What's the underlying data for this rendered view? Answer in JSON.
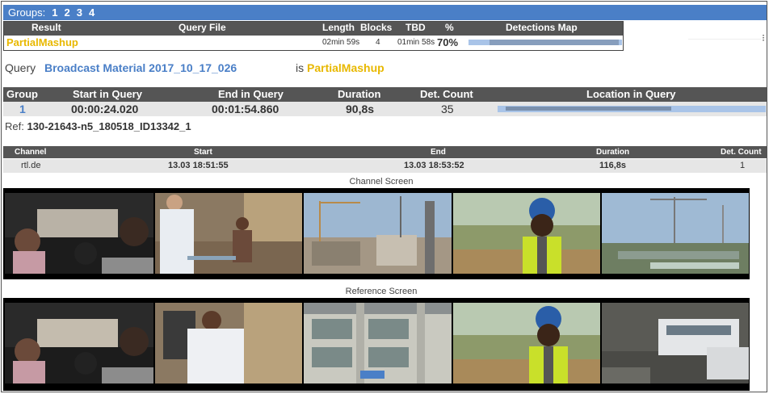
{
  "groups": {
    "label": "Groups:",
    "items": [
      "1",
      "2",
      "3",
      "4"
    ]
  },
  "result_table": {
    "headers": {
      "result": "Result",
      "query_file": "Query File",
      "length": "Length",
      "blocks": "Blocks",
      "tbd": "TBD",
      "pct": "%",
      "det_map": "Detections Map"
    },
    "row": {
      "result": "PartialMashup",
      "query_file": "",
      "length": "02min 59s",
      "blocks": "4",
      "tbd": "01min 58s",
      "pct": "70%"
    }
  },
  "query": {
    "label": "Query",
    "name": "Broadcast Material 2017_10_17_026",
    "is_label": "is",
    "status": "PartialMashup"
  },
  "group_table": {
    "headers": {
      "group": "Group",
      "start": "Start in Query",
      "end": "End in Query",
      "duration": "Duration",
      "det_count": "Det. Count",
      "location": "Location in Query"
    },
    "row": {
      "group": "1",
      "start": "00:00:24.020",
      "end": "00:01:54.860",
      "duration": "90,8s",
      "det_count": "35"
    }
  },
  "ref": {
    "label": "Ref:",
    "value": "130-21643-n5_180518_ID13342_1"
  },
  "channel_table": {
    "headers": {
      "channel": "Channel",
      "start": "Start",
      "end": "End",
      "duration": "Duration",
      "det_count": "Det. Count"
    },
    "row": {
      "channel": "rtl.de",
      "start": "13.03 18:51:55",
      "end": "13.03 18:53:52",
      "duration": "116,8s",
      "det_count": "1"
    }
  },
  "channel_screen_label": "Channel Screen",
  "reference_screen_label": "Reference Screen",
  "colors": {
    "accent_blue": "#4a7fc7",
    "status_yellow": "#e8b800",
    "header_gray": "#555555",
    "bar_light": "#a9c4e8",
    "bar_dark": "#6b7f99"
  }
}
